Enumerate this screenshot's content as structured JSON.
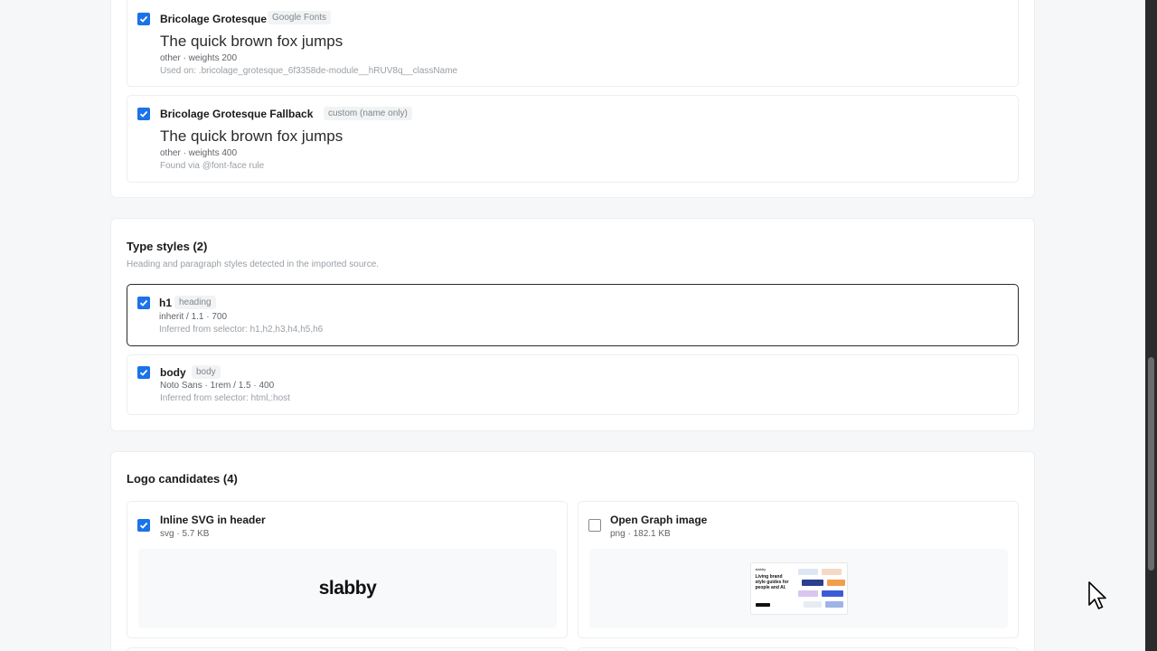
{
  "fonts": {
    "items": [
      {
        "name": "Bricolage Grotesque",
        "badge": "Google Fonts",
        "preview": "The quick brown fox jumps",
        "meta": "other · weights 200",
        "note": "Used on: .bricolage_grotesque_6f3358de-module__hRUV8q__className",
        "checked": true
      },
      {
        "name": "Bricolage Grotesque Fallback",
        "badge": "custom (name only)",
        "preview": "The quick brown fox jumps",
        "meta": "other · weights 400",
        "note": "Found via @font-face rule",
        "checked": true
      }
    ]
  },
  "type_styles": {
    "title": "Type styles (2)",
    "description": "Heading and paragraph styles detected in the imported source.",
    "items": [
      {
        "name": "h1",
        "badge": "heading",
        "meta": "inherit / 1.1 · 700",
        "note": "Inferred from selector: h1,h2,h3,h4,h5,h6",
        "checked": true,
        "selected": true
      },
      {
        "name": "body",
        "badge": "body",
        "meta": "Noto Sans · 1rem / 1.5 · 400",
        "note": "Inferred from selector: html,:host",
        "checked": true,
        "selected": false
      }
    ]
  },
  "logos": {
    "title": "Logo candidates (4)",
    "items": [
      {
        "name": "Inline SVG in header",
        "meta": "svg · 5.7 KB",
        "wordmark": "slabby",
        "checked": true
      },
      {
        "name": "Open Graph image",
        "meta": "png · 182.1 KB",
        "og_brand": "slabby",
        "og_headline": "Living brand style guides for people and AI.",
        "checked": false
      }
    ]
  },
  "colors": {
    "accent": "#1a73e8",
    "selected_border": "#2a2a2a"
  },
  "icons": {
    "check": "check-icon",
    "cursor": "mouse-pointer-icon"
  }
}
